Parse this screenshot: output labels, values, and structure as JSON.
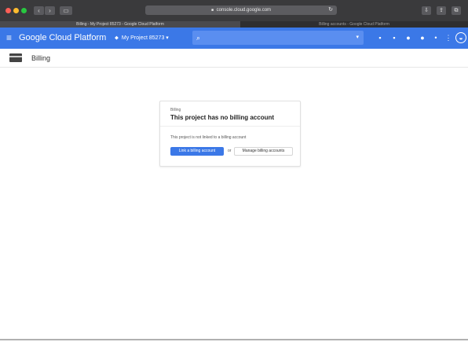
{
  "browser": {
    "url": "console.cloud.google.com",
    "url_lock_icon": "lock-icon",
    "back_icon": "‹",
    "forward_icon": "›",
    "sidebar_icon": "▭",
    "reload_icon": "↻",
    "share_icon": "⇪",
    "tabs_icon": "⧉",
    "download_icon": "⇩",
    "tabs": [
      {
        "label": "Billing - My Project 85273 - Google Cloud Platform",
        "active": true
      },
      {
        "label": "Billing accounts - Google Cloud Platform",
        "active": false
      }
    ]
  },
  "gcp_header": {
    "menu_icon": "≡",
    "title": "Google Cloud Platform",
    "project_label": "My Project 85273",
    "project_icon": "⬥",
    "project_caret": "▾",
    "search_icon": "⌕",
    "search_caret": "▾",
    "icons": [
      {
        "name": "cloud-shell-icon",
        "glyph": "▪"
      },
      {
        "name": "help-icon",
        "glyph": "▪"
      },
      {
        "name": "feedback-icon",
        "glyph": "●"
      },
      {
        "name": "notifications-icon",
        "glyph": "●"
      },
      {
        "name": "bell-icon",
        "glyph": "•"
      },
      {
        "name": "more-vert-icon",
        "glyph": "⋮"
      }
    ],
    "avatar_glyph": "◒"
  },
  "page": {
    "title": "Billing"
  },
  "card": {
    "eyebrow": "Billing",
    "heading": "This project has no billing account",
    "description": "This project is not linked to a billing account",
    "link_button": "Link a billing account",
    "or_text": "or",
    "manage_button": "Manage billing accounts"
  },
  "colors": {
    "gcp_blue": "#3b78e7",
    "titlebar": "#3a3a3c",
    "tabbar": "#2e2e30"
  }
}
